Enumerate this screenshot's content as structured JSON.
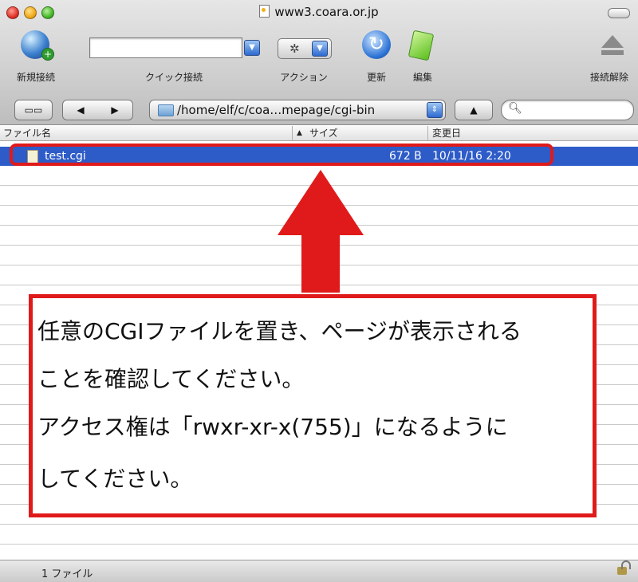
{
  "window": {
    "title": "www3.coara.or.jp"
  },
  "toolbar": {
    "new_connection": "新規接続",
    "quick_connect": "クイック接続",
    "quick_connect_value": "",
    "action": "アクション",
    "refresh": "更新",
    "edit": "編集",
    "disconnect": "接続解除"
  },
  "pathbar": {
    "path": "/home/elf/c/coa…mepage/cgi-bin",
    "search_value": ""
  },
  "columns": {
    "name": "ファイル名",
    "size": "サイズ",
    "modified": "変更日"
  },
  "files": [
    {
      "name": "test.cgi",
      "size": "672 B",
      "modified": "10/11/16 2:20",
      "selected": true
    }
  ],
  "annotation": {
    "lines": [
      "任意のCGIファイルを置き、ページが表示される",
      "ことを確認してください。",
      "アクセス権は「rwxr-xr-x(755)」になるように",
      "してください。"
    ],
    "color": "#e01a1a"
  },
  "status": {
    "count": "1 ファイル"
  },
  "colors": {
    "selection": "#2d5bc8"
  }
}
